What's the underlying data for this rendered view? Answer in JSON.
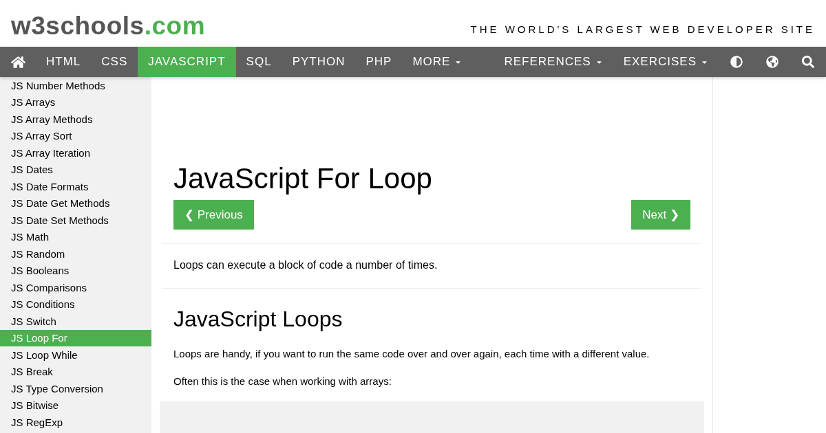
{
  "header": {
    "logo": {
      "name": "w3schools",
      "domain": ".com"
    },
    "tagline": "THE WORLD'S LARGEST WEB DEVELOPER SITE"
  },
  "nav": {
    "left": [
      {
        "label": "HTML",
        "selected": false,
        "dropdown": false
      },
      {
        "label": "CSS",
        "selected": false,
        "dropdown": false
      },
      {
        "label": "JAVASCRIPT",
        "selected": true,
        "dropdown": false
      },
      {
        "label": "SQL",
        "selected": false,
        "dropdown": false
      },
      {
        "label": "PYTHON",
        "selected": false,
        "dropdown": false
      },
      {
        "label": "PHP",
        "selected": false,
        "dropdown": false
      },
      {
        "label": "MORE",
        "selected": false,
        "dropdown": true
      }
    ],
    "right": [
      {
        "label": "REFERENCES",
        "selected": false,
        "dropdown": true
      },
      {
        "label": "EXERCISES",
        "selected": false,
        "dropdown": true
      }
    ]
  },
  "sidebar": {
    "items": [
      {
        "label": "JS Number Methods",
        "selected": false
      },
      {
        "label": "JS Arrays",
        "selected": false
      },
      {
        "label": "JS Array Methods",
        "selected": false
      },
      {
        "label": "JS Array Sort",
        "selected": false
      },
      {
        "label": "JS Array Iteration",
        "selected": false
      },
      {
        "label": "JS Dates",
        "selected": false
      },
      {
        "label": "JS Date Formats",
        "selected": false
      },
      {
        "label": "JS Date Get Methods",
        "selected": false
      },
      {
        "label": "JS Date Set Methods",
        "selected": false
      },
      {
        "label": "JS Math",
        "selected": false
      },
      {
        "label": "JS Random",
        "selected": false
      },
      {
        "label": "JS Booleans",
        "selected": false
      },
      {
        "label": "JS Comparisons",
        "selected": false
      },
      {
        "label": "JS Conditions",
        "selected": false
      },
      {
        "label": "JS Switch",
        "selected": false
      },
      {
        "label": "JS Loop For",
        "selected": true
      },
      {
        "label": "JS Loop While",
        "selected": false
      },
      {
        "label": "JS Break",
        "selected": false
      },
      {
        "label": "JS Type Conversion",
        "selected": false
      },
      {
        "label": "JS Bitwise",
        "selected": false
      },
      {
        "label": "JS RegExp",
        "selected": false
      }
    ]
  },
  "content": {
    "title": "JavaScript For Loop",
    "previous": "❮ Previous",
    "next": "Next ❯",
    "intro": "Loops can execute a block of code a number of times.",
    "heading": "JavaScript Loops",
    "paragraphs": [
      "Loops are handy, if you want to run the same code over and over again, each time with a different value.",
      "Often this is the case when working with arrays:"
    ]
  }
}
